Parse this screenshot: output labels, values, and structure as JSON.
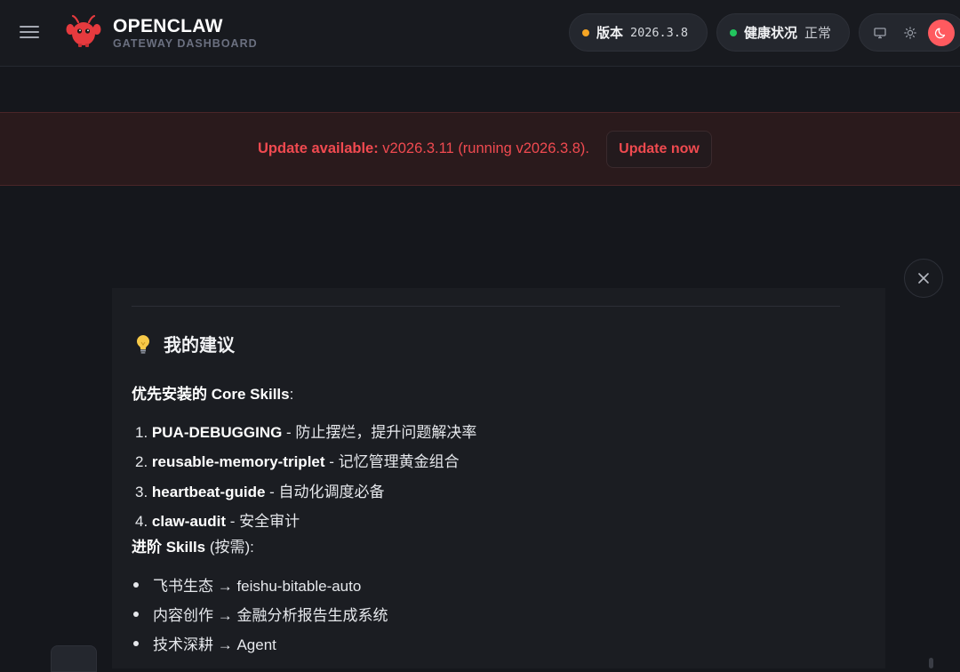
{
  "header": {
    "brand_title": "OPENCLAW",
    "brand_subtitle": "GATEWAY DASHBOARD",
    "version_label": "版本",
    "version_value": "2026.3.8",
    "health_label": "健康状况",
    "health_value": "正常",
    "theme_options": [
      "monitor-icon",
      "sun-icon",
      "moon-icon"
    ],
    "active_theme": "moon-icon"
  },
  "banner": {
    "prefix": "Update available:",
    "message": " v2026.3.11 (running v2026.3.8).",
    "button_label": "Update now"
  },
  "content": {
    "heading_icon": "lightbulb-icon",
    "heading": "我的建议",
    "core_intro_bold": "优先安装的 Core Skills",
    "core_intro_suffix": ":",
    "core_items": [
      {
        "num": "1.",
        "name": "PUA-DEBUGGING",
        "desc": " - 防止摆烂，提升问题解决率"
      },
      {
        "num": "2.",
        "name": "reusable-memory-triplet",
        "desc": " - 记忆管理黄金组合"
      },
      {
        "num": "3.",
        "name": "heartbeat-guide",
        "desc": " - 自动化调度必备"
      },
      {
        "num": "4.",
        "name": "claw-audit",
        "desc": " - 安全审计"
      }
    ],
    "adv_intro_bold": "进阶 Skills",
    "adv_intro_suffix": " (按需):",
    "adv_items": [
      "飞书生态 → feishu-bitable-auto",
      "内容创作 → 金融分析报告生成系统",
      "技术深耕 → Agent"
    ]
  },
  "colors": {
    "accent": "#ff5a5f",
    "version_dot": "#f5a524",
    "health_dot": "#22c55e",
    "banner_text": "#f04a50"
  }
}
